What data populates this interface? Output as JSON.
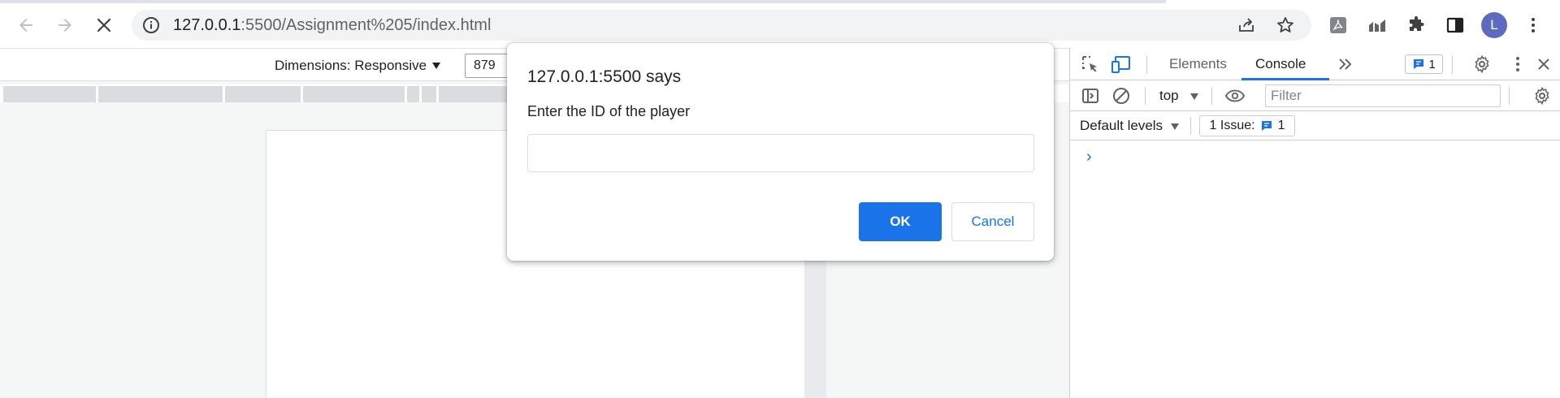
{
  "browser": {
    "url_host": "127.0.0.1",
    "url_rest": ":5500/Assignment%205/index.html",
    "profile_initial": "L",
    "icons": [
      "back-arrow-icon",
      "forward-arrow-icon",
      "stop-loading-icon",
      "site-info-icon",
      "share-icon",
      "bookmark-star-icon",
      "pdf-extension-icon",
      "chart-extension-icon",
      "puzzle-extensions-icon",
      "side-panel-icon",
      "kebab-menu-icon"
    ]
  },
  "device_toolbar": {
    "dimensions_label": "Dimensions: Responsive",
    "width_value": "879"
  },
  "dialog": {
    "title": "127.0.0.1:5500 says",
    "message": "Enter the ID of the player",
    "input_value": "",
    "ok_label": "OK",
    "cancel_label": "Cancel"
  },
  "devtools": {
    "tabs": [
      "Elements",
      "Console"
    ],
    "active_tab": "Console",
    "issue_badge_count": "1",
    "context_label": "top",
    "filter_placeholder": "Filter",
    "levels_label": "Default levels",
    "issues_label": "1 Issue:",
    "issues_count": "1",
    "prompt_glyph": "›"
  },
  "colors": {
    "accent_blue": "#1a73e8",
    "avatar": "#5c6bc0",
    "omnibox_bg": "#f1f3f4"
  }
}
